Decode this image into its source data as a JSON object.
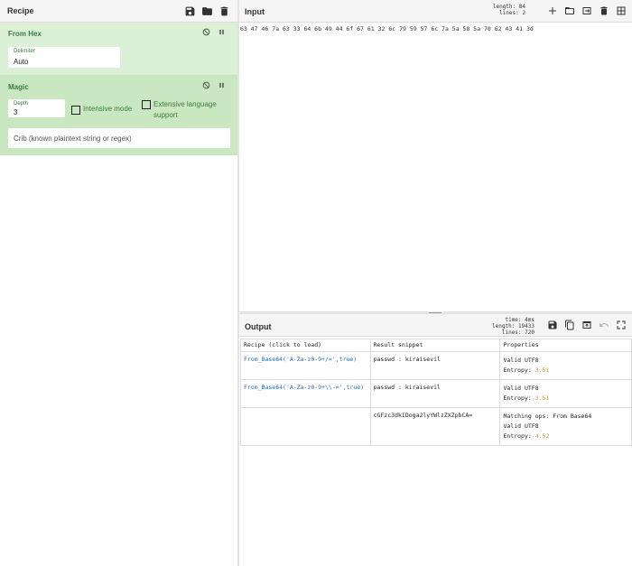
{
  "recipe": {
    "title": "Recipe",
    "operations": [
      {
        "name": "From Hex",
        "delimiter_label": "Delimiter",
        "delimiter_value": "Auto"
      },
      {
        "name": "Magic",
        "depth_label": "Depth",
        "depth_value": "3",
        "intensive_label": "Intensive mode",
        "extensive_label": "Extensive language support",
        "crib_placeholder": "Crib (known plaintext string or regex)"
      }
    ]
  },
  "input": {
    "title": "Input",
    "length_label": "length:",
    "length_value": "84",
    "lines_label": "lines:",
    "lines_value": "2",
    "text": "63 47 46 7a 63 33 64 6b 49 44 6f 67 61 32 6c 79 59 57 6c 7a 5a 58 5a 70 62 43 41 3d"
  },
  "output": {
    "title": "Output",
    "time_label": "time:",
    "time_value": "4ms",
    "length_label": "length:",
    "length_value": "19433",
    "lines_label": "lines:",
    "lines_value": "720",
    "headers": [
      "Recipe (click to load)",
      "Result snippet",
      "Properties"
    ],
    "rows": [
      {
        "recipe": "From_Base64('A-Za-z0-9+/=',true)",
        "snippet": "passwd : kiraisevil",
        "props": [
          "Valid UTF8"
        ],
        "entropy_label": "Entropy:",
        "entropy": "3.51"
      },
      {
        "recipe": "From_Base64('A-Za-z0-9+\\\\-=',true)",
        "snippet": "passwd : kiraisevil",
        "props": [
          "Valid UTF8"
        ],
        "entropy_label": "Entropy:",
        "entropy": "3.51"
      },
      {
        "recipe": "",
        "snippet": "cGFzc3dkIDoga2lyYWlzZXZpbCA=",
        "props": [
          "Matching ops: From Base64",
          "Valid UTF8"
        ],
        "entropy_label": "Entropy:",
        "entropy": "4.52"
      }
    ]
  },
  "colors": {
    "op_from_hex": "#dcf0d8",
    "op_magic": "#c9e7c1",
    "op_title": "#3f7a3f",
    "link": "#2a6fc4",
    "entropy": "#c8a02a"
  },
  "icons": [
    "save-icon",
    "folder-icon",
    "trash-icon",
    "disable-icon",
    "pause-icon",
    "plus-icon",
    "open-folder-icon",
    "swap-icon",
    "copy-icon",
    "replace-input-icon",
    "undo-icon",
    "maximize-icon"
  ]
}
